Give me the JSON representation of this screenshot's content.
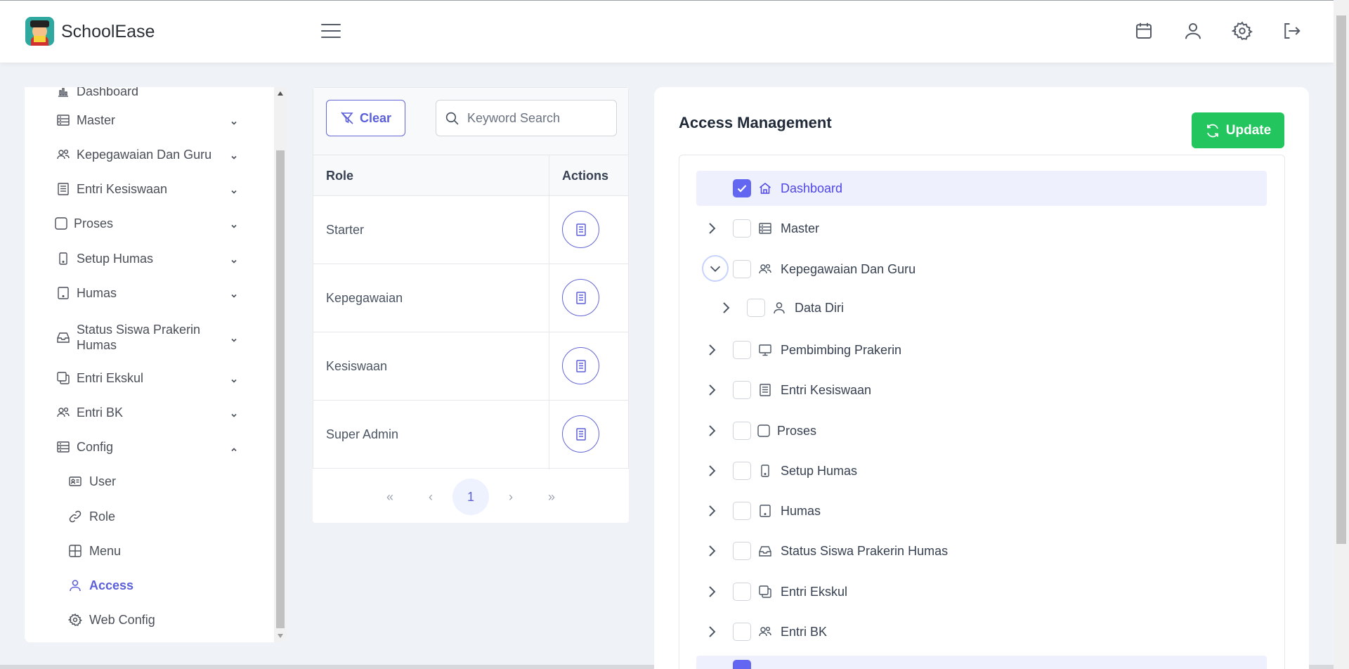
{
  "app": {
    "title": "SchoolEase"
  },
  "sidebar": {
    "items": [
      {
        "label": "Dashboard",
        "icon": "chart-icon"
      },
      {
        "label": "Master",
        "icon": "server-icon"
      },
      {
        "label": "Kepegawaian Dan Guru",
        "icon": "users-icon"
      },
      {
        "label": "Entri Kesiswaan",
        "icon": "list-icon"
      },
      {
        "label": "Proses",
        "icon": "square-icon"
      },
      {
        "label": "Setup Humas",
        "icon": "mobile-icon"
      },
      {
        "label": "Humas",
        "icon": "tablet-icon"
      },
      {
        "label": "Status Siswa Prakerin",
        "label2": "Humas",
        "icon": "inbox-icon"
      },
      {
        "label": "Entri Ekskul",
        "icon": "clone-icon"
      },
      {
        "label": "Entri BK",
        "icon": "users-icon"
      },
      {
        "label": "Config",
        "icon": "server-icon"
      }
    ],
    "config_children": [
      {
        "label": "User",
        "icon": "id-card-icon"
      },
      {
        "label": "Role",
        "icon": "link-icon"
      },
      {
        "label": "Menu",
        "icon": "table-icon"
      },
      {
        "label": "Access",
        "icon": "user-icon",
        "active": true
      },
      {
        "label": "Web Config",
        "icon": "gear-icon"
      }
    ]
  },
  "roles_panel": {
    "clear_label": "Clear",
    "search_placeholder": "Keyword Search",
    "columns": [
      "Role",
      "Actions"
    ],
    "rows": [
      "Starter",
      "Kepegawaian",
      "Kesiswaan",
      "Super Admin"
    ],
    "pagination": {
      "first": "«",
      "prev": "‹",
      "current": "1",
      "next": "›",
      "last": "»"
    }
  },
  "access_panel": {
    "title": "Access Management",
    "update_label": "Update",
    "tree": [
      {
        "label": "Dashboard",
        "icon": "home-icon",
        "checked": true
      },
      {
        "label": "Master",
        "icon": "server-icon",
        "checked": false
      },
      {
        "label": "Kepegawaian Dan Guru",
        "icon": "users-icon",
        "checked": false,
        "expanded": true
      },
      {
        "label": "Data Diri",
        "icon": "user-icon",
        "checked": false,
        "child": true
      },
      {
        "label": "Pembimbing Prakerin",
        "icon": "monitor-icon",
        "checked": false
      },
      {
        "label": "Entri Kesiswaan",
        "icon": "list-icon",
        "checked": false
      },
      {
        "label": "Proses",
        "icon": "square-icon",
        "checked": false
      },
      {
        "label": "Setup Humas",
        "icon": "mobile-icon",
        "checked": false
      },
      {
        "label": "Humas",
        "icon": "tablet-icon",
        "checked": false
      },
      {
        "label": "Status Siswa Prakerin Humas",
        "icon": "inbox-icon",
        "checked": false
      },
      {
        "label": "Entri Ekskul",
        "icon": "clone-icon",
        "checked": false
      },
      {
        "label": "Entri BK",
        "icon": "users-icon",
        "checked": false
      }
    ]
  },
  "colors": {
    "accent": "#5b5fd9",
    "success": "#22c55e",
    "background": "#eff2f7"
  }
}
